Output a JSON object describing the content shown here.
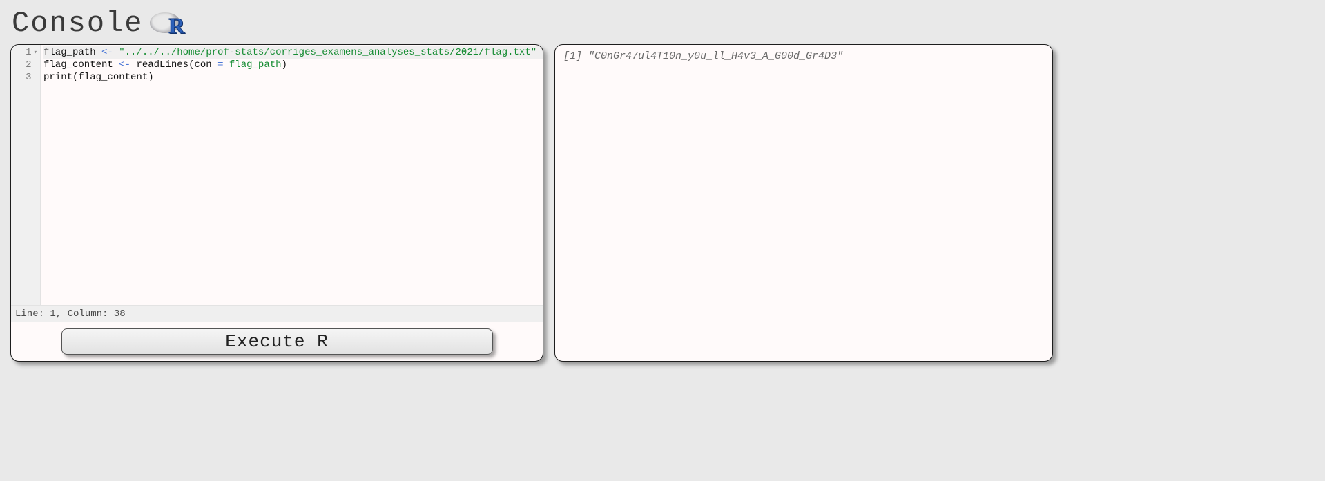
{
  "header": {
    "title": "Console"
  },
  "editor": {
    "lines": [
      "1",
      "2",
      "3"
    ],
    "code": {
      "l1": {
        "var": "flag_path",
        "assign": " <- ",
        "str": "\"../../../home/prof-stats/corriges_examens_analyses_stats/2021/flag.txt\""
      },
      "l2": {
        "var": "flag_content",
        "assign": " <- ",
        "fn": "readLines",
        "open": "(",
        "arg": "con",
        "eq": " = ",
        "ident": "flag_path",
        "close": ")"
      },
      "l3": {
        "fn": "print",
        "open": "(",
        "arg": "flag_content",
        "close": ")"
      }
    },
    "status": "Line: 1, Column: 38"
  },
  "actions": {
    "execute_label": "Execute R"
  },
  "output": {
    "text": "[1] \"C0nGr47ul4T10n_y0u_ll_H4v3_A_G00d_Gr4D3\""
  }
}
